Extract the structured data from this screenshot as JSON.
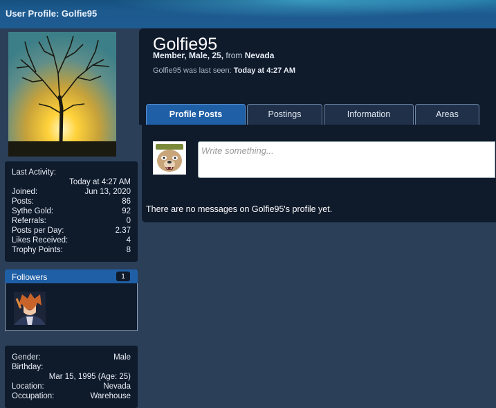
{
  "page": {
    "title": "User Profile: Golfie95"
  },
  "profile": {
    "username": "Golfie95",
    "user_title": "Member, Male, 25,",
    "from_label": "from",
    "location": "Nevada",
    "last_seen_prefix": "Golfie95 was last seen:",
    "last_seen_value": "Today at 4:27 AM"
  },
  "tabs": [
    {
      "label": "Profile Posts",
      "active": true
    },
    {
      "label": "Postings",
      "active": false
    },
    {
      "label": "Information",
      "active": false
    },
    {
      "label": "Areas",
      "active": false
    }
  ],
  "profile_posts": {
    "placeholder": "Write something...",
    "empty_message": "There are no messages on Golfie95's profile yet."
  },
  "stats": {
    "last_activity_label": "Last Activity:",
    "last_activity_value": "Today at 4:27 AM",
    "rows": [
      {
        "label": "Joined:",
        "value": "Jun 13, 2020"
      },
      {
        "label": "Posts:",
        "value": "86"
      },
      {
        "label": "Sythe Gold:",
        "value": "92"
      },
      {
        "label": "Referrals:",
        "value": "0"
      },
      {
        "label": "Posts per Day:",
        "value": "2.37"
      },
      {
        "label": "Likes Received:",
        "value": "4"
      },
      {
        "label": "Trophy Points:",
        "value": "8"
      }
    ]
  },
  "followers": {
    "label": "Followers",
    "count": "1"
  },
  "about": {
    "gender_label": "Gender:",
    "gender_value": "Male",
    "birthday_label": "Birthday:",
    "birthday_value": "Mar 15, 1995 (Age: 25)",
    "location_label": "Location:",
    "location_value": "Nevada",
    "occupation_label": "Occupation:",
    "occupation_value": "Warehouse"
  },
  "colors": {
    "accent": "#1f5fa6",
    "panel": "#0f1a2b",
    "page_bg": "#2b3f58"
  }
}
